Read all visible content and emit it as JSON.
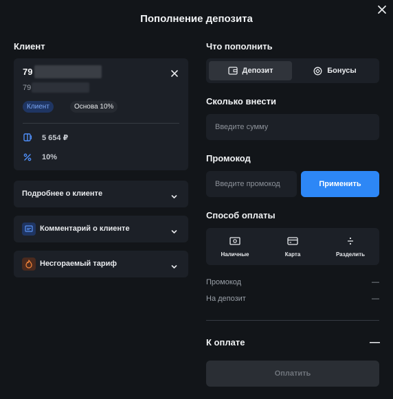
{
  "modal": {
    "title": "Пополнение депозита"
  },
  "client": {
    "section_label": "Клиент",
    "name": "79",
    "phone": "79",
    "badge_role": "Клиент",
    "badge_plan": "Основа 10%",
    "balance": "5 654 ₽",
    "discount": "10%"
  },
  "accordions": [
    {
      "label": "Подробнее о клиенте"
    },
    {
      "label": "Комментарий о клиенте"
    },
    {
      "label": "Несгораемый тариф"
    }
  ],
  "topup": {
    "section_label": "Что пополнить",
    "tabs": [
      {
        "label": "Депозит",
        "active": true
      },
      {
        "label": "Бонусы",
        "active": false
      }
    ]
  },
  "amount": {
    "section_label": "Сколько внести",
    "placeholder": "Введите сумму"
  },
  "promo": {
    "section_label": "Промокод",
    "placeholder": "Введите промокод",
    "apply_label": "Применить"
  },
  "payment": {
    "section_label": "Способ оплаты",
    "methods": [
      {
        "label": "Наличные"
      },
      {
        "label": "Карта"
      },
      {
        "label": "Разделить"
      }
    ]
  },
  "summary": {
    "rows": [
      {
        "label": "Промокод",
        "value": "—"
      },
      {
        "label": "На депозит",
        "value": "—"
      }
    ],
    "total_label": "К оплате",
    "total_value": "—",
    "pay_label": "Оплатить"
  },
  "colors": {
    "accent": "#2d87f6",
    "background": "#121519",
    "card": "#1c2027"
  }
}
